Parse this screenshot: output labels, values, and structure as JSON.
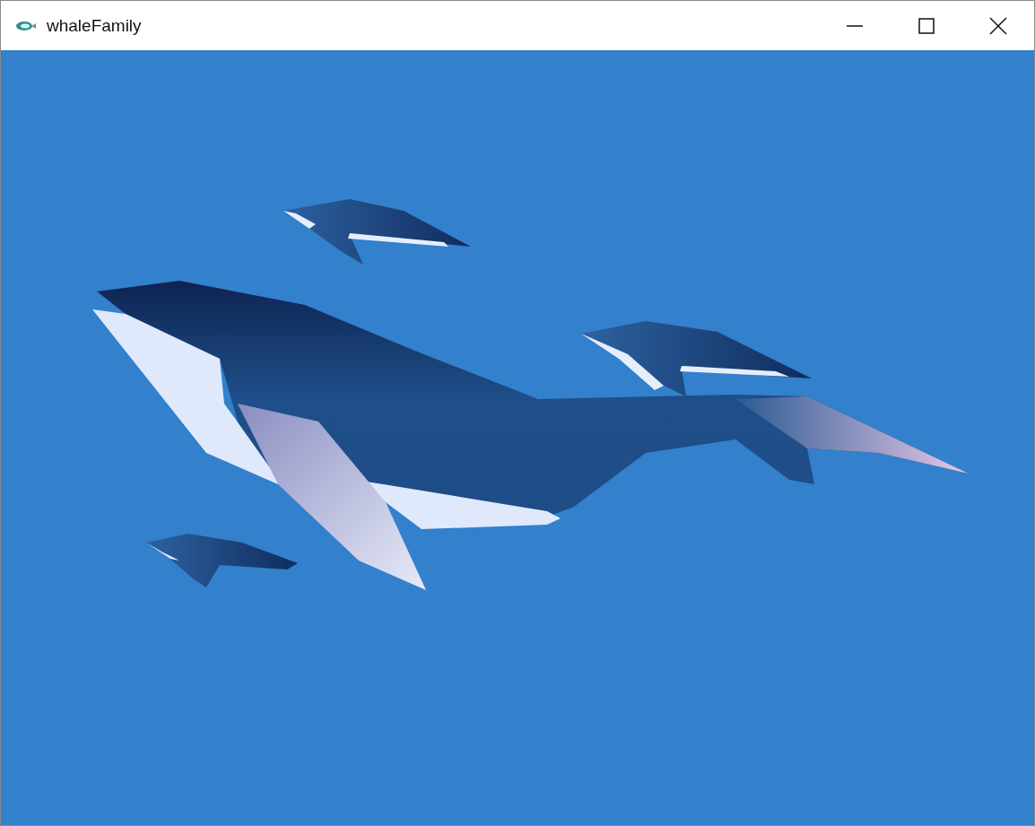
{
  "window": {
    "title": "whaleFamily"
  }
}
